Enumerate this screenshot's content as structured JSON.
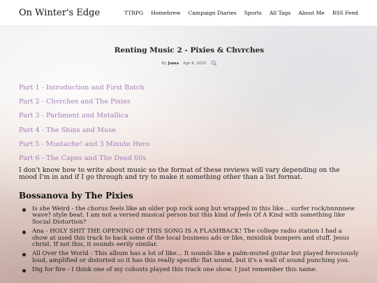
{
  "header": {
    "site_title": "On Winter's Edge",
    "nav": [
      "TTRPG",
      "Homebrew",
      "Campaign Diaries",
      "Sports",
      "All Tags",
      "About Me",
      "RSS Feed"
    ]
  },
  "post": {
    "title": "Renting Music 2 - Pixies & Chvrches",
    "by_label": "By",
    "author": "Jama",
    "date": "Apr 8, 2025",
    "search_icon": "search-icon",
    "parts": [
      "Part 1 - Introduction and First Batch",
      "Part 2 - Chvrches and The Pixies",
      "Part 3 - Parliment and Metallica",
      "Part 4 - The Shins and Muse",
      "Part 5 - Mustache! and 3 Minute Hero",
      "Part 6 - The Capes and The Dead 60s"
    ],
    "intro": "I don't know how to write about music so the format of these reviews will vary depending on the mood I'm in and if I go through and try to make it something other than a list format.",
    "section_heading": "Bossanova by The Pixies",
    "reviews": [
      "Is she Weird - the chorus feels like an older pop rock song but wrapped in this like... surfer rock/nnnnnew wave? style beat. I am not a versed musical person but this kind of feels Of A Kind with something like Social Distortion?",
      "Ana - HOLY SHIT THE OPENING OF THIS SONG IS A FLASHBACK! The college radio station I had a show at used this track to back some of the local business ads or like, minidisk bumpers and stuff. Jesus christ. If not this, it sounds eerily similar.",
      "All Over the World - This album has a lot of like... It sounds like a palm-muted guitar but played ferociously loud, amplified or distorted so it has this really specific flat sound, but it's a wall of sound punching you.",
      "Dig for fire - I think one of my cohosts played this track one show. I just remember this name."
    ]
  },
  "colors": {
    "link": "#a47eb9",
    "header_bg": "#ffffff",
    "text": "#1e1e1e"
  }
}
